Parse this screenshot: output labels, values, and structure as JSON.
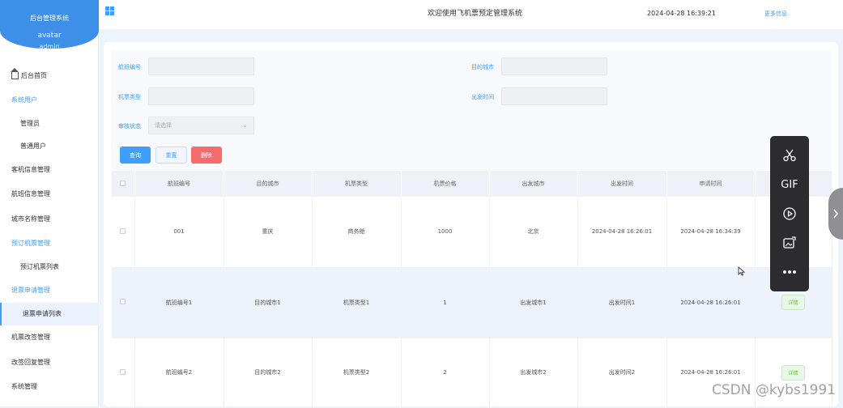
{
  "sidebar": {
    "app_title": "后台管理系统",
    "avatar_alt": "avatar",
    "username": "admin",
    "items": [
      {
        "label": "后台首页"
      },
      {
        "label": "系统用户"
      },
      {
        "label": "管理员"
      },
      {
        "label": "普通用户"
      },
      {
        "label": "客机信息管理"
      },
      {
        "label": "航班信息管理"
      },
      {
        "label": "城市名称管理"
      },
      {
        "label": "预订机票管理"
      },
      {
        "label": "预订机票列表"
      },
      {
        "label": "退票申请管理"
      },
      {
        "label": "退票申请列表"
      },
      {
        "label": "机票改签管理"
      },
      {
        "label": "改签回复管理"
      },
      {
        "label": "系统管理"
      }
    ]
  },
  "topbar": {
    "welcome": "欢迎使用飞机票预定管理系统",
    "datetime": "2024-04-28 16:39:21",
    "more": "更多信息"
  },
  "search": {
    "flight_no_label": "航班编号",
    "dest_city_label": "目的城市",
    "ticket_type_label": "机票类型",
    "depart_time_label": "出发时间",
    "audit_status_label": "审核状态",
    "audit_status_placeholder": "请选择",
    "query_button": "查询",
    "reset_button": "重置",
    "delete_button": "删除"
  },
  "table": {
    "headers": [
      "航班编号",
      "目的城市",
      "机票类型",
      "机票价格",
      "出发城市",
      "出发时间",
      "申请时间"
    ],
    "rows": [
      {
        "cells": [
          "001",
          "重庆",
          "商务舱",
          "1000",
          "北京",
          "2024-04-28 16:26:01",
          "2024-04-28 16:34:39"
        ],
        "action": ""
      },
      {
        "cells": [
          "航班编号1",
          "目的城市1",
          "机票类型1",
          "1",
          "出发城市1",
          "出发时间1",
          "2024-04-28 16:26:01"
        ],
        "action": "详情"
      },
      {
        "cells": [
          "航班编号2",
          "目的城市2",
          "机票类型2",
          "2",
          "出发城市2",
          "出发时间2",
          "2024-04-28 16:26:01"
        ],
        "action": "详情"
      }
    ]
  },
  "floating_toolbar": {
    "gif_label": "GIF",
    "icons": [
      "scissors-icon",
      "gif-icon",
      "record-icon",
      "image-icon",
      "more-icon"
    ]
  },
  "watermark": "CSDN @kybs1991",
  "colors": {
    "accent": "#409eff",
    "danger": "#f56c6c",
    "success": "#67c23a"
  }
}
